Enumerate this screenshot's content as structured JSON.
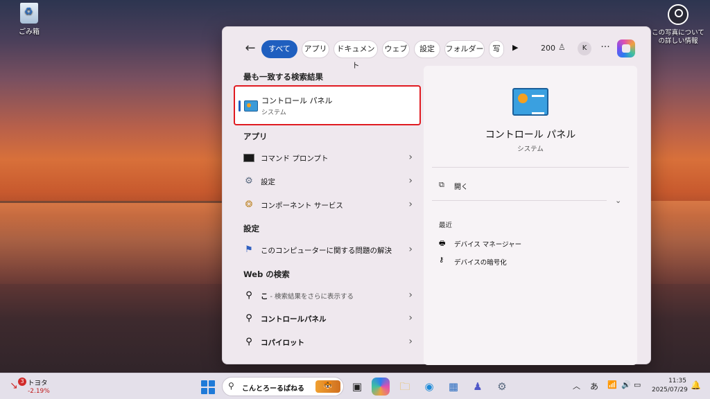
{
  "desktop": {
    "recycle_bin_label": "ごみ箱",
    "photo_info_label": "この写真についての詳しい情報"
  },
  "search": {
    "filters": [
      "すべて",
      "アプリ",
      "ドキュメント",
      "ウェブ",
      "設定",
      "フォルダー",
      "写"
    ],
    "points": "200",
    "avatar_initial": "K",
    "best_match_heading": "最も一致する検索結果",
    "best_match": {
      "title": "コントロール パネル",
      "subtitle": "システム"
    },
    "apps_heading": "アプリ",
    "apps": [
      {
        "label": "コマンド プロンプト",
        "icon": "command-prompt-icon"
      },
      {
        "label": "設定",
        "icon": "settings-gear-icon"
      },
      {
        "label": "コンポーネント サービス",
        "icon": "component-services-icon"
      }
    ],
    "settings_heading": "設定",
    "settings": [
      {
        "label": "このコンピューターに関する問題の解決",
        "icon": "troubleshoot-flag-icon"
      }
    ],
    "web_heading": "Web の検索",
    "web": [
      {
        "query": "こ",
        "hint": " - 検索結果をさらに表示する"
      },
      {
        "query": "コントロールパネル",
        "hint": ""
      },
      {
        "query": "コパイロット",
        "hint": ""
      }
    ]
  },
  "preview": {
    "title": "コントロール パネル",
    "subtitle": "システム",
    "open_label": "開く",
    "recent_heading": "最近",
    "recent": [
      {
        "label": "デバイス マネージャー",
        "icon": "device-manager-icon"
      },
      {
        "label": "デバイスの暗号化",
        "icon": "device-encryption-icon"
      }
    ]
  },
  "taskbar": {
    "stock_name": "トヨタ",
    "stock_change": "-2.19%",
    "stock_badge": "3",
    "search_text": "こんとろーるぱねる",
    "tray_ime": "あ",
    "time": "11:35",
    "date": "2025/07/29"
  }
}
